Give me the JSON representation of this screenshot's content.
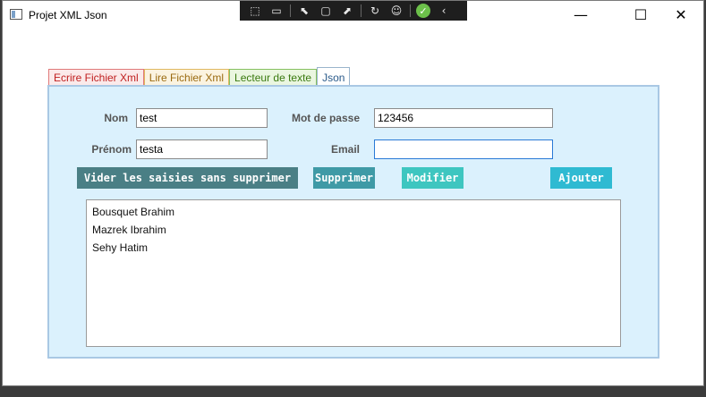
{
  "window": {
    "title": "Projet XML Json",
    "minimize": "—",
    "maximize": "☐",
    "close": "✕"
  },
  "debug_toolbar": {
    "icons": [
      "select-element-icon",
      "camera-icon",
      "cursor-icon",
      "frame-icon",
      "track-focus-icon",
      "hot-reload-icon",
      "accessibility-icon",
      "check-icon",
      "collapse-icon"
    ]
  },
  "tabs": [
    {
      "label": "Ecrire Fichier Xml",
      "active": false
    },
    {
      "label": "Lire Fichier Xml",
      "active": false
    },
    {
      "label": "Lecteur de texte",
      "active": false
    },
    {
      "label": "Json",
      "active": true
    }
  ],
  "form": {
    "nom_label": "Nom",
    "nom_value": "test",
    "prenom_label": "Prénom",
    "prenom_value": "testa",
    "password_label": "Mot de passe",
    "password_value": "123456",
    "email_label": "Email",
    "email_value": ""
  },
  "buttons": {
    "clear": "Vider les saisies sans supprimer",
    "delete": "Supprimer",
    "modify": "Modifier",
    "add": "Ajouter"
  },
  "colors": {
    "clear": "#4a7f85",
    "delete": "#3f9aa6",
    "modify": "#3ec6c0",
    "add": "#2fbad2"
  },
  "list": {
    "items": [
      "Bousquet Brahim",
      "Mazrek Ibrahim",
      "Sehy Hatim"
    ]
  }
}
